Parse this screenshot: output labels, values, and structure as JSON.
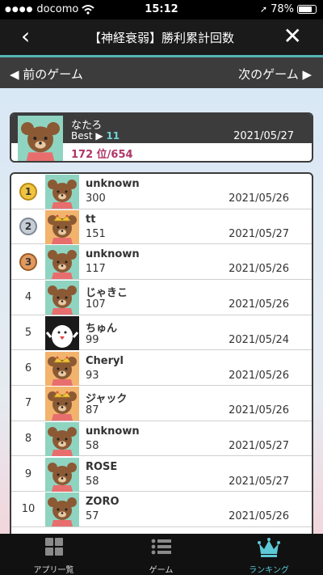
{
  "status": {
    "carrier": "docomo",
    "time": "15:12",
    "battery": "78%"
  },
  "navbar": {
    "title": "【神経衰弱】勝利累計回数"
  },
  "gamenav": {
    "prev": "◀ 前のゲーム",
    "next": "次のゲーム ▶"
  },
  "me": {
    "name": "なたろ",
    "best_label": "Best ▶",
    "best_value": "11",
    "date": "2021/05/27",
    "rank": "172 位/654"
  },
  "rows": [
    {
      "rank": "1",
      "medal": "gold",
      "avatar": "bear",
      "name": "unknown",
      "score": "300",
      "date": "2021/05/26"
    },
    {
      "rank": "2",
      "medal": "silver",
      "avatar": "bear-crown",
      "name": "tt",
      "score": "151",
      "date": "2021/05/27"
    },
    {
      "rank": "3",
      "medal": "bronze",
      "avatar": "bear",
      "name": "unknown",
      "score": "117",
      "date": "2021/05/26"
    },
    {
      "rank": "4",
      "avatar": "bear",
      "name": "じゃきこ",
      "score": "107",
      "date": "2021/05/26"
    },
    {
      "rank": "5",
      "avatar": "bird",
      "name": "ちゅん",
      "score": "99",
      "date": "2021/05/24"
    },
    {
      "rank": "6",
      "avatar": "bear-crown",
      "name": "Cheryl",
      "score": "93",
      "date": "2021/05/26"
    },
    {
      "rank": "7",
      "avatar": "bear-crown",
      "name": "ジャック",
      "score": "87",
      "date": "2021/05/26"
    },
    {
      "rank": "8",
      "avatar": "bear",
      "name": "unknown",
      "score": "58",
      "date": "2021/05/27"
    },
    {
      "rank": "9",
      "avatar": "bear",
      "name": "ROSE",
      "score": "58",
      "date": "2021/05/27"
    },
    {
      "rank": "10",
      "avatar": "bear",
      "name": "ZORO",
      "score": "57",
      "date": "2021/05/26"
    }
  ],
  "tabs": [
    {
      "label": "アプリ一覧",
      "icon": "grid-icon"
    },
    {
      "label": "ゲーム",
      "icon": "list-icon"
    },
    {
      "label": "ランキング",
      "icon": "crown-icon",
      "active": true
    }
  ],
  "colors": {
    "accent": "#56b4b6",
    "rank_text": "#b0356a",
    "active_tab": "#5cc9d6",
    "gold": "#f0c440",
    "silver": "#c7cdd6",
    "bronze": "#e09a60"
  }
}
